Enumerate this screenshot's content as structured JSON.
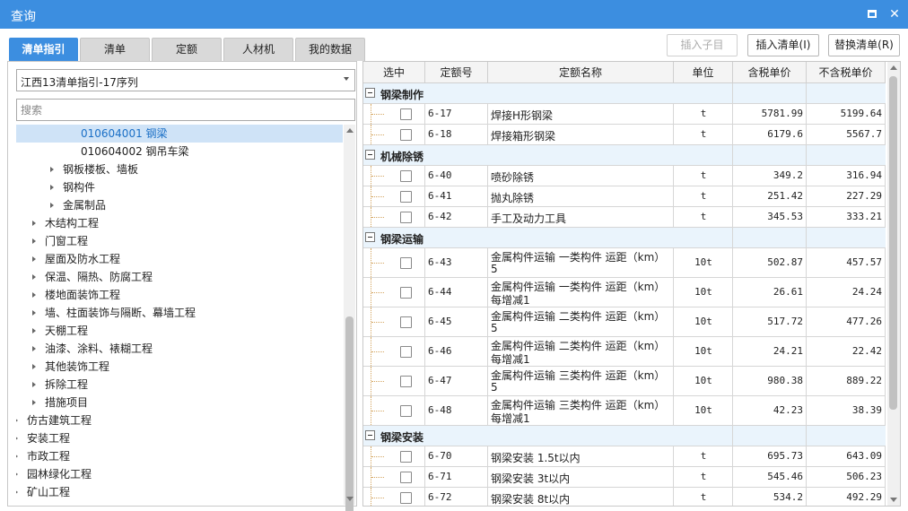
{
  "window": {
    "title": "查询"
  },
  "tabs": [
    "清单指引",
    "清单",
    "定额",
    "人材机",
    "我的数据"
  ],
  "actions": {
    "insert_child": "插入子目",
    "insert_list": "插入清单(I)",
    "replace_list": "替换清单(R)"
  },
  "left": {
    "dropdown_value": "江西13清单指引-17序列",
    "search_placeholder": "搜索",
    "tree": [
      {
        "label": "010604001  钢梁",
        "selected": true,
        "caret": false
      },
      {
        "label": "010604002  钢吊车梁",
        "caret": false
      },
      {
        "label": "钢板楼板、墙板",
        "caret": true
      },
      {
        "label": "钢构件",
        "caret": true
      },
      {
        "label": "金属制品",
        "caret": true
      },
      {
        "label": "木结构工程",
        "caret": true
      },
      {
        "label": "门窗工程",
        "caret": true
      },
      {
        "label": "屋面及防水工程",
        "caret": true
      },
      {
        "label": "保温、隔热、防腐工程",
        "caret": true
      },
      {
        "label": "楼地面装饰工程",
        "caret": true
      },
      {
        "label": "墙、柱面装饰与隔断、幕墙工程",
        "caret": true
      },
      {
        "label": "天棚工程",
        "caret": true
      },
      {
        "label": "油漆、涂料、裱糊工程",
        "caret": true
      },
      {
        "label": "其他装饰工程",
        "caret": true
      },
      {
        "label": "拆除工程",
        "caret": true
      },
      {
        "label": "措施项目",
        "caret": true
      },
      {
        "label": "仿古建筑工程",
        "caret": true
      },
      {
        "label": "安装工程",
        "caret": true
      },
      {
        "label": "市政工程",
        "caret": true
      },
      {
        "label": "园林绿化工程",
        "caret": true
      },
      {
        "label": "矿山工程",
        "caret": true
      }
    ]
  },
  "table": {
    "headers": [
      "选中",
      "定额号",
      "定额名称",
      "单位",
      "含税单价",
      "不含税单价"
    ],
    "groups": [
      {
        "name": "钢梁制作",
        "rows": [
          {
            "code": "6-17",
            "name": [
              "焊接H形钢梁"
            ],
            "unit": "t",
            "tax": "5781.99",
            "notax": "5199.64"
          },
          {
            "code": "6-18",
            "name": [
              "焊接箱形钢梁"
            ],
            "unit": "t",
            "tax": "6179.6",
            "notax": "5567.7"
          }
        ]
      },
      {
        "name": "机械除锈",
        "rows": [
          {
            "code": "6-40",
            "name": [
              "喷砂除锈"
            ],
            "unit": "t",
            "tax": "349.2",
            "notax": "316.94"
          },
          {
            "code": "6-41",
            "name": [
              "抛丸除锈"
            ],
            "unit": "t",
            "tax": "251.42",
            "notax": "227.29"
          },
          {
            "code": "6-42",
            "name": [
              "手工及动力工具"
            ],
            "unit": "t",
            "tax": "345.53",
            "notax": "333.21"
          }
        ]
      },
      {
        "name": "钢梁运输",
        "rows": [
          {
            "code": "6-43",
            "name": [
              "金属构件运输 一类构件 运距（km）",
              "5"
            ],
            "unit": "10t",
            "tax": "502.87",
            "notax": "457.57"
          },
          {
            "code": "6-44",
            "name": [
              "金属构件运输 一类构件 运距（km）",
              "每增减1"
            ],
            "unit": "10t",
            "tax": "26.61",
            "notax": "24.24"
          },
          {
            "code": "6-45",
            "name": [
              "金属构件运输 二类构件 运距（km）",
              "5"
            ],
            "unit": "10t",
            "tax": "517.72",
            "notax": "477.26"
          },
          {
            "code": "6-46",
            "name": [
              "金属构件运输 二类构件 运距（km）",
              "每增减1"
            ],
            "unit": "10t",
            "tax": "24.21",
            "notax": "22.42"
          },
          {
            "code": "6-47",
            "name": [
              "金属构件运输 三类构件 运距（km）",
              "5"
            ],
            "unit": "10t",
            "tax": "980.38",
            "notax": "889.22"
          },
          {
            "code": "6-48",
            "name": [
              "金属构件运输 三类构件 运距（km）",
              "每增减1"
            ],
            "unit": "10t",
            "tax": "42.23",
            "notax": "38.39"
          }
        ]
      },
      {
        "name": "钢梁安装",
        "rows": [
          {
            "code": "6-70",
            "name": [
              "钢梁安装 1.5t以内"
            ],
            "unit": "t",
            "tax": "695.73",
            "notax": "643.09"
          },
          {
            "code": "6-71",
            "name": [
              "钢梁安装 3t以内"
            ],
            "unit": "t",
            "tax": "545.46",
            "notax": "506.23"
          },
          {
            "code": "6-72",
            "name": [
              "钢梁安装 8t以内"
            ],
            "unit": "t",
            "tax": "534.2",
            "notax": "492.29"
          }
        ]
      }
    ]
  }
}
